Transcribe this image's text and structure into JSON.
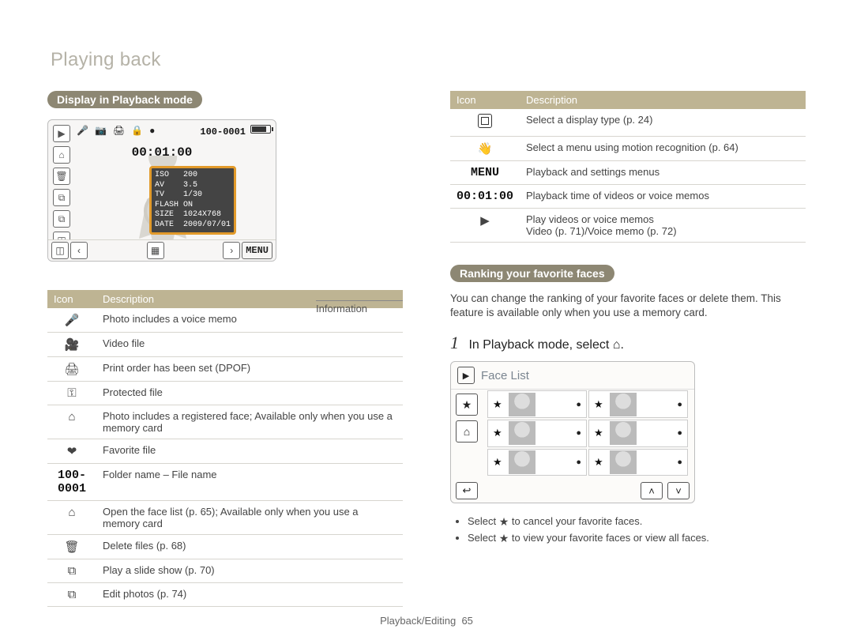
{
  "section_title": "Playing back",
  "left": {
    "pill": "Display in Playback mode",
    "display": {
      "file_number": "100-0001",
      "timer": "00:01:00",
      "info_label": "Information",
      "info_rows": [
        {
          "k": "ISO",
          "v": "200"
        },
        {
          "k": "AV",
          "v": "3.5"
        },
        {
          "k": "TV",
          "v": "1/30"
        },
        {
          "k": "FLASH",
          "v": "ON"
        },
        {
          "k": "SIZE",
          "v": "1024X768"
        },
        {
          "k": "DATE",
          "v": "2009/07/01"
        }
      ],
      "top_icons": [
        "●",
        "🔒",
        "🎤",
        "📷",
        "🖨"
      ],
      "left_buttons": [
        "▶",
        "⌂",
        "🗑",
        "⧉",
        "⧉",
        "◫"
      ],
      "bottom_buttons": {
        "left": "◫",
        "prev": "‹",
        "thumb": "▦",
        "next": "›",
        "menu": "MENU"
      }
    },
    "table_header": {
      "icon": "Icon",
      "desc": "Description"
    },
    "rows": [
      {
        "icon": "🎤",
        "icon_name": "voice-memo-icon",
        "desc": "Photo includes a voice memo"
      },
      {
        "icon": "🎥",
        "icon_name": "video-file-icon",
        "desc": "Video file"
      },
      {
        "icon": "🖨",
        "icon_name": "print-order-icon",
        "desc": "Print order has been set (DPOF)"
      },
      {
        "icon": "⚿",
        "icon_name": "protected-file-icon",
        "desc": "Protected file"
      },
      {
        "icon": "⌂",
        "icon_name": "registered-face-icon",
        "desc": "Photo includes a registered face; Available only when you use a memory card"
      },
      {
        "icon": "❤",
        "icon_name": "favorite-file-icon",
        "desc": "Favorite file"
      },
      {
        "icon": "100-0001",
        "icon_name": "folder-file-name",
        "mono": true,
        "desc": "Folder name – File name"
      },
      {
        "icon": "⌂",
        "icon_name": "open-face-list-icon",
        "desc": "Open the face list (p. 65); Available only when you use a memory card"
      },
      {
        "icon": "🗑",
        "icon_name": "delete-files-icon",
        "desc": "Delete files (p. 68)"
      },
      {
        "icon": "⧉",
        "icon_name": "slideshow-icon",
        "desc": "Play a slide show (p. 70)"
      },
      {
        "icon": "⧉",
        "icon_name": "edit-photos-icon",
        "desc": "Edit photos (p. 74)"
      }
    ]
  },
  "right": {
    "table_header": {
      "icon": "Icon",
      "desc": "Description"
    },
    "rows": [
      {
        "icon": "inner-box",
        "icon_name": "display-type-icon",
        "desc": "Select a display type (p. 24)"
      },
      {
        "icon": "👋",
        "icon_name": "motion-recognition-icon",
        "desc": "Select a menu using motion recognition (p. 64)"
      },
      {
        "icon": "MENU",
        "icon_name": "menu-icon",
        "mono": true,
        "desc": "Playback and settings menus"
      },
      {
        "icon": "00:01:00",
        "icon_name": "playback-time-icon",
        "mono": true,
        "desc": "Playback time of videos or voice memos"
      },
      {
        "icon": "▶",
        "icon_name": "play-icon",
        "desc": "Play videos or voice memos\nVideo (p. 71)/Voice memo (p. 72)"
      }
    ],
    "pill": "Ranking your favorite faces",
    "intro": "You can change the ranking of your favorite faces or delete them. This feature is available only when you use a memory card.",
    "step1_prefix": "1",
    "step1_text_before": "In Playback mode, select",
    "step1_text_after": ".",
    "facelist_title": "Face List",
    "face_cards": [
      {
        "star": "★",
        "dot": "●"
      },
      {
        "star": "★",
        "dot": "●"
      },
      {
        "star": "★",
        "dot": "●"
      },
      {
        "star": "★",
        "dot": "●"
      },
      {
        "star": "★",
        "dot": "●"
      },
      {
        "star": "★",
        "dot": "●"
      }
    ],
    "side_buttons": [
      "★",
      "⌂"
    ],
    "bottom_buttons": {
      "back": "↩",
      "up": "˄",
      "down": "˅"
    },
    "bullets": [
      {
        "pre": "Select ",
        "icon": "★",
        "icon_name": "star-off-icon",
        "post": " to cancel your favorite faces."
      },
      {
        "pre": "Select ",
        "icon": "★",
        "icon_name": "star-icon",
        "post": " to view your favorite faces or view all faces."
      }
    ]
  },
  "footer_section": "Playback/Editing",
  "footer_page": "65"
}
